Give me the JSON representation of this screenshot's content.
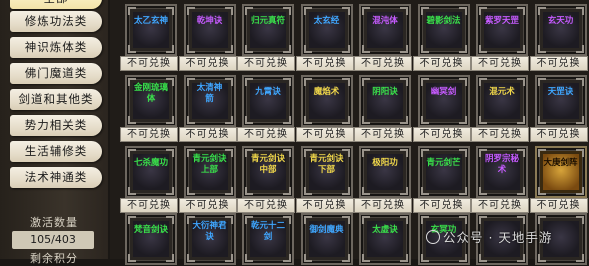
{
  "sidebar": {
    "top_tab": "全部",
    "tabs": [
      "修炼功法类",
      "神识炼体类",
      "佛门魔道类",
      "剑道和其他类",
      "势力相关类",
      "生活辅修类",
      "法术神通类"
    ],
    "activation_label": "激活数量",
    "activation_value": "105/403",
    "bottom_label": "剩余积分"
  },
  "button_label": "不可兑换",
  "colors": {
    "green": "#39e04a",
    "purple": "#c65bff",
    "yellow": "#f1d84a",
    "blue": "#3fa7ff"
  },
  "rows": [
    [
      {
        "name": "太乙玄神",
        "color": "blue"
      },
      {
        "name": "乾坤诀",
        "color": "purple"
      },
      {
        "name": "归元真符",
        "color": "green"
      },
      {
        "name": "太玄经",
        "color": "blue"
      },
      {
        "name": "混沌体",
        "color": "purple"
      },
      {
        "name": "碧影剑法",
        "color": "green"
      },
      {
        "name": "紫罗天罡",
        "color": "purple"
      },
      {
        "name": "玄天功",
        "color": "purple"
      }
    ],
    [
      {
        "name": "金刚琉璃\n体",
        "color": "green"
      },
      {
        "name": "太清神\n箭",
        "color": "blue"
      },
      {
        "name": "九霄诀",
        "color": "blue"
      },
      {
        "name": "魔焰术",
        "color": "yellow"
      },
      {
        "name": "阴阳诀",
        "color": "green"
      },
      {
        "name": "幽冥剑",
        "color": "purple"
      },
      {
        "name": "混元术",
        "color": "yellow"
      },
      {
        "name": "天罡诀",
        "color": "blue"
      }
    ],
    [
      {
        "name": "七杀魔功",
        "color": "green"
      },
      {
        "name": "青元剑诀\n上部",
        "color": "green"
      },
      {
        "name": "青元剑诀\n中部",
        "color": "yellow"
      },
      {
        "name": "青元剑诀\n下部",
        "color": "yellow"
      },
      {
        "name": "极阳功",
        "color": "yellow"
      },
      {
        "name": "青元剑芒",
        "color": "green"
      },
      {
        "name": "阴罗宗秘\n术",
        "color": "purple"
      },
      {
        "name": "大庚剑阵",
        "color": "gold"
      }
    ],
    [
      {
        "name": "梵音剑诀",
        "color": "green"
      },
      {
        "name": "大衍神君\n诀",
        "color": "blue"
      },
      {
        "name": "乾元十二\n剑",
        "color": "blue"
      },
      {
        "name": "御剑魔典",
        "color": "blue"
      },
      {
        "name": "太虚诀",
        "color": "green"
      },
      {
        "name": "玄冥功",
        "color": "green"
      },
      {
        "name": "",
        "color": "green"
      },
      {
        "name": "",
        "color": "green"
      }
    ]
  ],
  "watermark": "公众号 · 天地手游"
}
